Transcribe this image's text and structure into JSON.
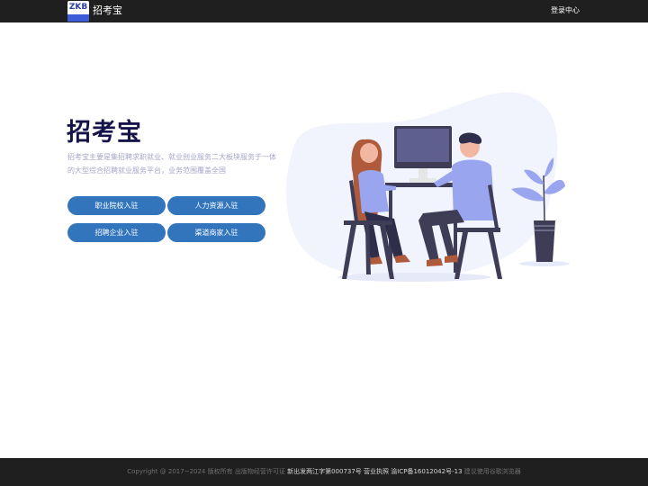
{
  "header": {
    "logo_text": "ZKB",
    "brand": "招考宝",
    "login": "登录中心"
  },
  "hero": {
    "title": "招考宝",
    "description": "招考宝主要是集招聘求职就业、就业创业服务二大板块服务于一体的大型综合招聘就业服务平台，业务范围覆盖全国"
  },
  "buttons": [
    {
      "label": "职业院校入驻"
    },
    {
      "label": "人力资源入驻"
    },
    {
      "label": "招聘企业入驻"
    },
    {
      "label": "渠道商家入驻"
    }
  ],
  "footer": {
    "copyright": "Copyright @ 2017~2024 版权所有",
    "license_label": "出版物经营许可证",
    "license_value": "新出发两江字第000737号",
    "business_license": "营业执照",
    "icp": "渝ICP备16012042号-13",
    "browser_tip": "建议使用谷歌浏览器"
  },
  "colors": {
    "header_bg": "#1f1f1f",
    "title": "#15134a",
    "description": "#a5a6c9",
    "button": "#3275bd",
    "illustration_accent": "#9aa5f0",
    "illustration_blob": "#f1f3fd"
  }
}
